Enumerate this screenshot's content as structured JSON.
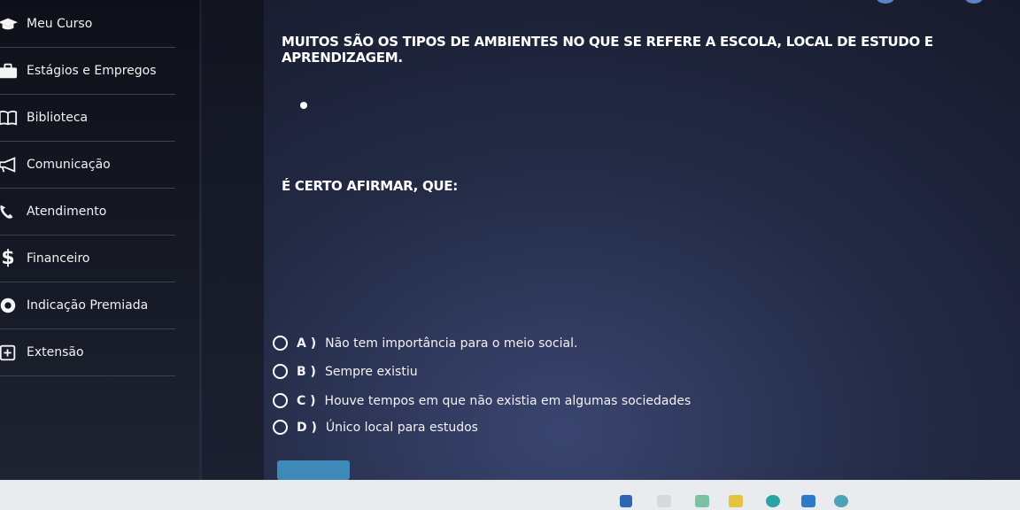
{
  "sidebar": {
    "items": [
      {
        "label": "Meu Curso",
        "icon": "graduation-cap-icon"
      },
      {
        "label": "Estágios e Empregos",
        "icon": "briefcase-icon"
      },
      {
        "label": "Biblioteca",
        "icon": "book-icon"
      },
      {
        "label": "Comunicação",
        "icon": "megaphone-icon"
      },
      {
        "label": "Atendimento",
        "icon": "phone-icon"
      },
      {
        "label": "Financeiro",
        "icon": "dollar-icon"
      },
      {
        "label": "Indicação Premiada",
        "icon": "award-icon"
      },
      {
        "label": "Extensão",
        "icon": "plus-box-icon"
      }
    ]
  },
  "quiz": {
    "question": "MUITOS SÃO OS TIPOS DE AMBIENTES NO QUE SE REFERE A ESCOLA, LOCAL DE ESTUDO E APRENDIZAGEM.",
    "prompt": "É CERTO AFIRMAR, QUE:",
    "options": [
      {
        "letter": "A )",
        "text": "Não tem importância para o meio social."
      },
      {
        "letter": "B )",
        "text": "Sempre existiu"
      },
      {
        "letter": "C )",
        "text": "Houve tempos em que não existia em algumas sociedades"
      },
      {
        "letter": "D )",
        "text": "Único local para estudos"
      }
    ]
  },
  "colors": {
    "sidebar_bg": "#0e1019",
    "text": "#ffffff",
    "submit_bg": "#3d89b8"
  }
}
